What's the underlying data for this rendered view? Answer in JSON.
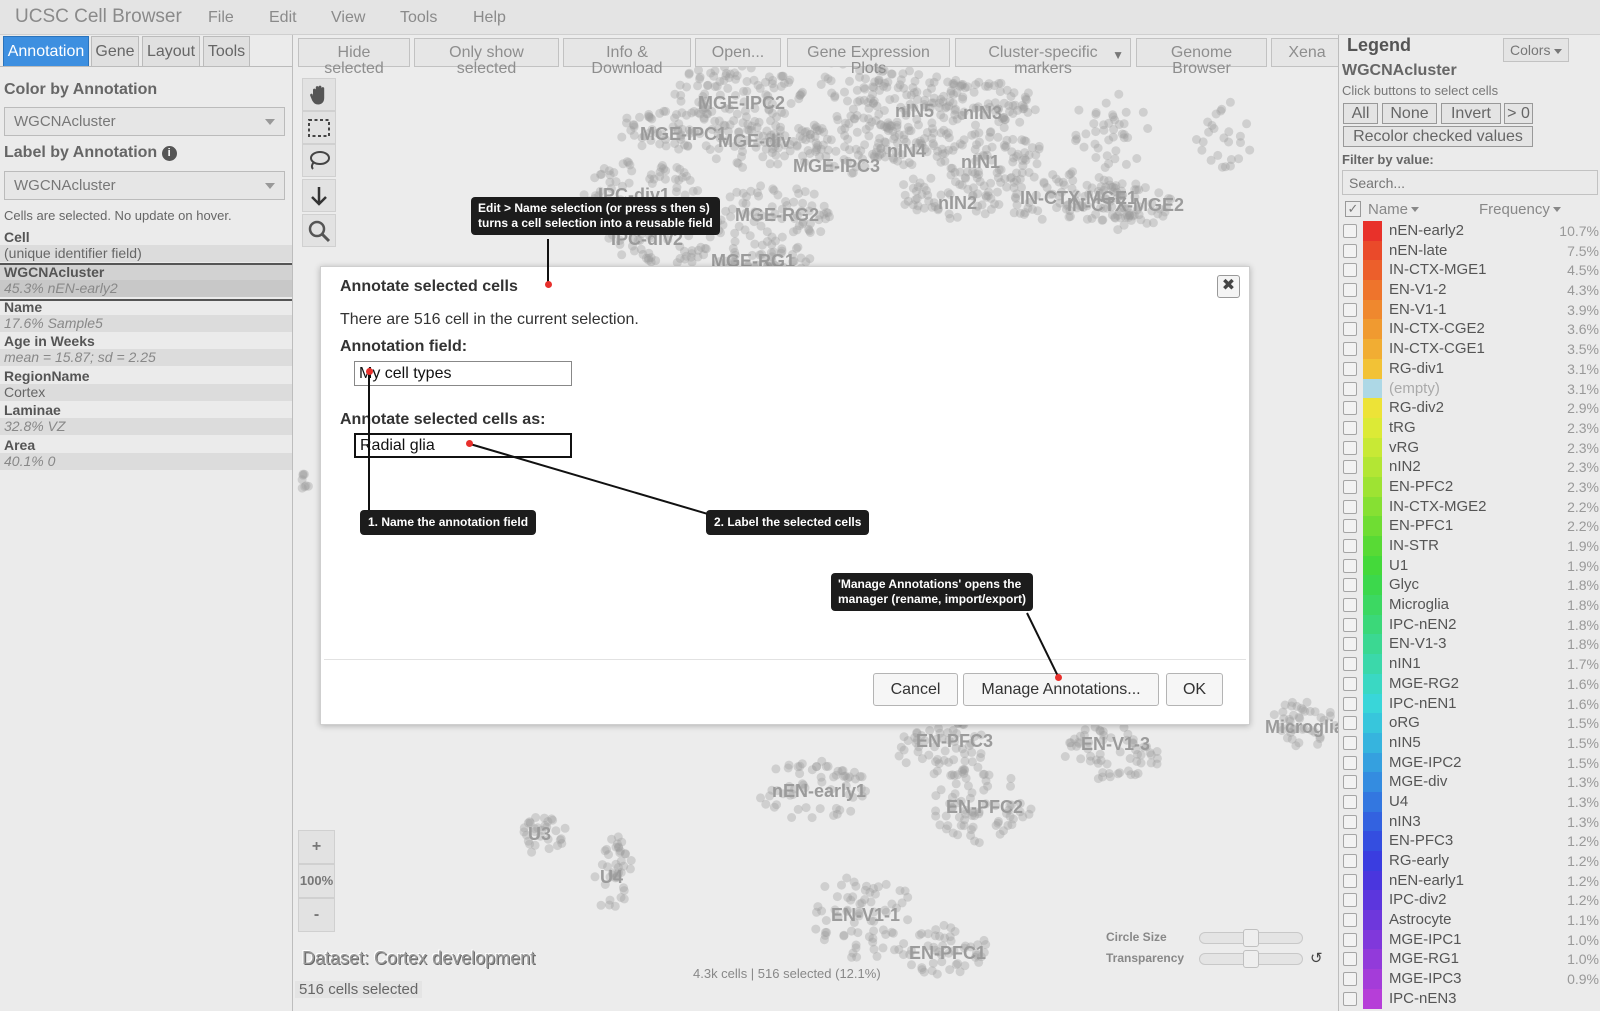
{
  "menubar": {
    "app_title": "UCSC Cell Browser",
    "items": [
      "File",
      "Edit",
      "View",
      "Tools",
      "Help"
    ]
  },
  "left_panel": {
    "tabs": [
      "Annotation",
      "Gene",
      "Layout",
      "Tools"
    ],
    "active_tab": "Annotation",
    "color_by_label": "Color by Annotation",
    "color_by_value": "WGCNAcluster",
    "label_by_label": "Label by Annotation",
    "label_by_value": "WGCNAcluster",
    "hover_note": "Cells are selected. No update on hover.",
    "meta": [
      {
        "label": "Cell",
        "value": "(unique identifier field)",
        "style": "plain"
      },
      {
        "label": "WGCNAcluster",
        "value": "45.3% nEN-early2",
        "style": "italic"
      },
      {
        "label": "Name",
        "value": "17.6% Sample5",
        "style": "italic"
      },
      {
        "label": "Age in Weeks",
        "value": "mean = 15.87; sd = 2.25",
        "style": "italic"
      },
      {
        "label": "RegionName",
        "value": "Cortex",
        "style": "plain"
      },
      {
        "label": "Laminae",
        "value": "32.8% VZ",
        "style": "italic"
      },
      {
        "label": "Area",
        "value": "40.1% 0",
        "style": "italic"
      }
    ]
  },
  "toolbar": {
    "buttons": [
      {
        "line1": "Hide",
        "line2": "selected"
      },
      {
        "line1": "Only show",
        "line2": "selected"
      },
      {
        "line1": "Info &",
        "line2": "Download"
      },
      {
        "line1": "Open...",
        "line2": ""
      },
      {
        "line1": "Gene Expression",
        "line2": "Plots"
      },
      {
        "line1": "Cluster-specific",
        "line2": "markers"
      },
      {
        "line1": "Genome",
        "line2": "Browser"
      },
      {
        "line1": "Xena",
        "line2": ""
      }
    ]
  },
  "plot": {
    "cluster_labels": [
      "MGE-IPC2",
      "MGE-IPC1",
      "MGE-div",
      "MGE-IPC3",
      "nIN5",
      "nIN3",
      "nIN4",
      "nIN1",
      "nIN2",
      "IN-CTX-MGE1",
      "IN-CTX-MGE2",
      "IPC-div1",
      "MGE-RG2",
      "IPC-div2",
      "MGE-RG1",
      "EN-PFC3",
      "EN-V1-3",
      "nEN-early1",
      "EN-PFC2",
      "U3",
      "U4",
      "EN-V1-1",
      "EN-PFC1",
      "Microglia"
    ],
    "zoom": {
      "plus": "+",
      "level": "100%",
      "minus": "-"
    },
    "dataset_label": "Dataset: Cortex development",
    "cell_counts": "4.3k cells | 516 selected (12.1%)",
    "status": "516 cells selected",
    "circle_size_label": "Circle Size",
    "transparency_label": "Transparency",
    "circle_size_value": 0.5,
    "transparency_value": 0.5
  },
  "dialog": {
    "title": "Annotate selected cells",
    "close": "✖",
    "message": "There are 516 cell in the current selection.",
    "field_label": "Annotation field:",
    "field_value": "My cell types",
    "as_label": "Annotate selected cells as:",
    "as_value": "Radial glia",
    "cancel": "Cancel",
    "manage": "Manage Annotations...",
    "ok": "OK"
  },
  "callouts": {
    "edit_name_line1": "Edit > Name selection (or press s then s)",
    "edit_name_line2": "turns a cell selection into a reusable field",
    "step1": "1. Name the annotation field",
    "step2": "2. Label the selected cells",
    "manage_line1": "'Manage Annotations' opens the",
    "manage_line2": "manager (rename, import/export)"
  },
  "legend": {
    "title": "Legend",
    "colors_button": "Colors",
    "field": "WGCNAcluster",
    "hint": "Click buttons to select cells",
    "buttons": [
      "All",
      "None",
      "Invert",
      "> 0"
    ],
    "recolor": "Recolor checked values",
    "filter_label": "Filter by value:",
    "filter_placeholder": "Search...",
    "col_name": "Name",
    "col_freq": "Frequency",
    "rows": [
      {
        "name": "nEN-early2",
        "freq": "10.7%",
        "color": "#e8312a"
      },
      {
        "name": "nEN-late",
        "freq": "7.5%",
        "color": "#ea4a2a"
      },
      {
        "name": "IN-CTX-MGE1",
        "freq": "4.5%",
        "color": "#ec5f2b"
      },
      {
        "name": "EN-V1-2",
        "freq": "4.3%",
        "color": "#ee742c"
      },
      {
        "name": "EN-V1-1",
        "freq": "3.9%",
        "color": "#ef882e"
      },
      {
        "name": "IN-CTX-CGE2",
        "freq": "3.6%",
        "color": "#f09a30"
      },
      {
        "name": "IN-CTX-CGE1",
        "freq": "3.5%",
        "color": "#f1ad33"
      },
      {
        "name": "RG-div1",
        "freq": "3.1%",
        "color": "#f2c236"
      },
      {
        "name": "(empty)",
        "freq": "3.1%",
        "color": "#add8e6",
        "muted": true
      },
      {
        "name": "RG-div2",
        "freq": "2.9%",
        "color": "#ede337"
      },
      {
        "name": "tRG",
        "freq": "2.3%",
        "color": "#dcea36"
      },
      {
        "name": "vRG",
        "freq": "2.3%",
        "color": "#c8e935"
      },
      {
        "name": "nIN2",
        "freq": "2.3%",
        "color": "#b3e634"
      },
      {
        "name": "EN-PFC2",
        "freq": "2.3%",
        "color": "#9ee333"
      },
      {
        "name": "IN-CTX-MGE2",
        "freq": "2.2%",
        "color": "#86e033"
      },
      {
        "name": "EN-PFC1",
        "freq": "2.2%",
        "color": "#6fdd33"
      },
      {
        "name": "IN-STR",
        "freq": "1.9%",
        "color": "#58da35"
      },
      {
        "name": "U1",
        "freq": "1.9%",
        "color": "#44d93a"
      },
      {
        "name": "Glyc",
        "freq": "1.8%",
        "color": "#3cd84c"
      },
      {
        "name": "Microglia",
        "freq": "1.8%",
        "color": "#3cd862"
      },
      {
        "name": "IPC-nEN2",
        "freq": "1.8%",
        "color": "#3bd879"
      },
      {
        "name": "EN-V1-3",
        "freq": "1.8%",
        "color": "#3bd892"
      },
      {
        "name": "nIN1",
        "freq": "1.7%",
        "color": "#3bd8aa"
      },
      {
        "name": "MGE-RG2",
        "freq": "1.6%",
        "color": "#3ad8c3"
      },
      {
        "name": "IPC-nEN1",
        "freq": "1.6%",
        "color": "#39d6d9"
      },
      {
        "name": "oRG",
        "freq": "1.5%",
        "color": "#37c6dc"
      },
      {
        "name": "nIN5",
        "freq": "1.5%",
        "color": "#36b4de"
      },
      {
        "name": "MGE-IPC2",
        "freq": "1.5%",
        "color": "#35a0df"
      },
      {
        "name": "MGE-div",
        "freq": "1.3%",
        "color": "#348ce0"
      },
      {
        "name": "U4",
        "freq": "1.3%",
        "color": "#3377e0"
      },
      {
        "name": "nIN3",
        "freq": "1.3%",
        "color": "#3362e0"
      },
      {
        "name": "EN-PFC3",
        "freq": "1.2%",
        "color": "#344ee0"
      },
      {
        "name": "RG-early",
        "freq": "1.2%",
        "color": "#3a3de0"
      },
      {
        "name": "nEN-early1",
        "freq": "1.2%",
        "color": "#4a36de"
      },
      {
        "name": "IPC-div2",
        "freq": "1.2%",
        "color": "#5c36dd"
      },
      {
        "name": "Astrocyte",
        "freq": "1.1%",
        "color": "#6e37dc"
      },
      {
        "name": "MGE-IPC1",
        "freq": "1.0%",
        "color": "#8038db"
      },
      {
        "name": "MGE-RG1",
        "freq": "1.0%",
        "color": "#923ada"
      },
      {
        "name": "MGE-IPC3",
        "freq": "0.9%",
        "color": "#a43cd9"
      },
      {
        "name": "IPC-nEN3",
        "freq": "",
        "color": "#b63ed8"
      }
    ]
  }
}
